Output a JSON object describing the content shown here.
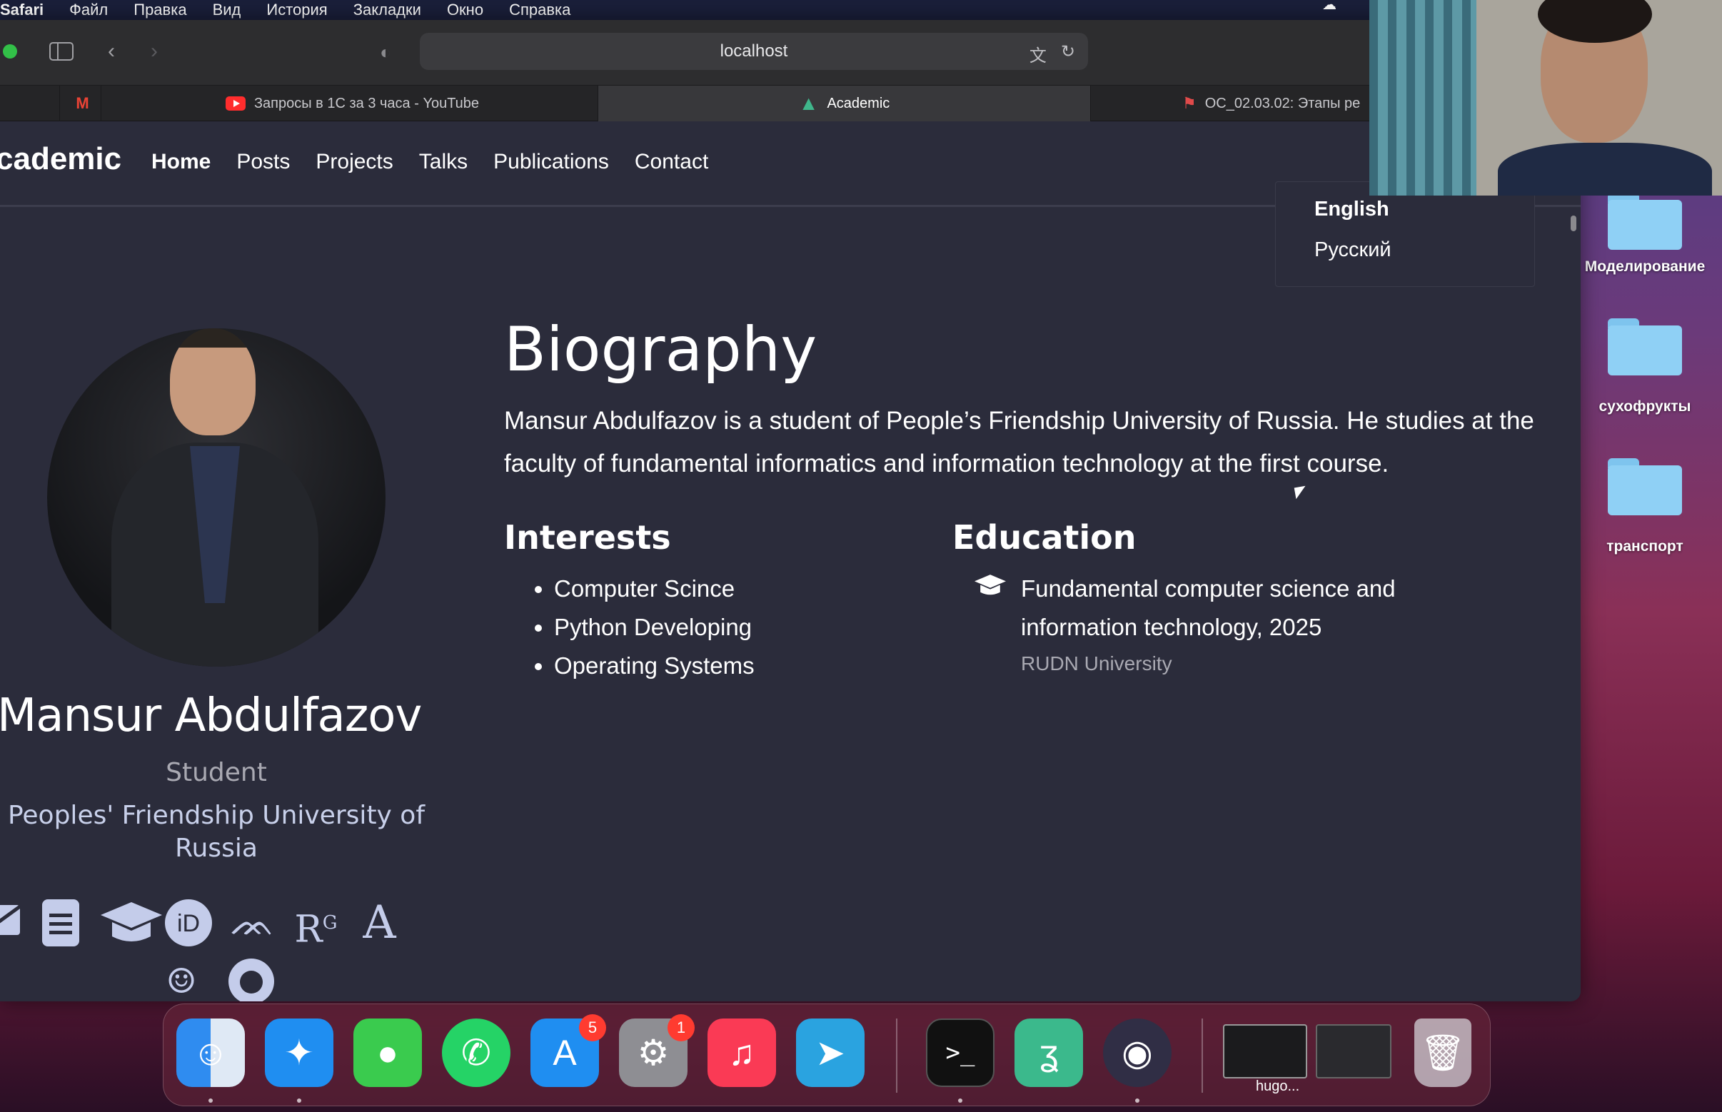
{
  "menubar": {
    "items": [
      "Safari",
      "Файл",
      "Правка",
      "Вид",
      "История",
      "Закладки",
      "Окно",
      "Справка"
    ]
  },
  "toolbar": {
    "address": "localhost",
    "back_icon": "chevron-left-icon",
    "forward_icon": "chevron-right-icon"
  },
  "tabs": [
    {
      "label": "Запросы в 1С за 3 часа - YouTube",
      "icon": "youtube-icon",
      "active": false
    },
    {
      "label": "Academic",
      "icon": "academic-icon",
      "active": true
    },
    {
      "label": "ОС_02.03.02: Этапы ре",
      "icon": "moodle-icon",
      "active": false
    }
  ],
  "site": {
    "brand": "cademic",
    "nav": [
      "Home",
      "Posts",
      "Projects",
      "Talks",
      "Publications",
      "Contact"
    ],
    "lang_menu": [
      "English",
      "Русский"
    ]
  },
  "profile": {
    "name": "Mansur Abdulfazov",
    "role": "Student",
    "organization": "Peoples' Friendship University of Russia",
    "social_icons": [
      "envelope-icon",
      "cv-icon",
      "graduation-cap-icon",
      "orcid-icon",
      "mendeley-icon",
      "researchgate-icon",
      "academia-icon",
      "keybase-icon",
      "github-icon"
    ]
  },
  "biography": {
    "title": "Biography",
    "text": "Mansur Abdulfazov is a student of People’s Friendship University of Russia. He studies at the faculty of fundamental informatics and information technology at the first course."
  },
  "interests": {
    "title": "Interests",
    "items": [
      "Computer Scince",
      "Python Developing",
      "Operating Systems"
    ]
  },
  "education": {
    "title": "Education",
    "course": "Fundamental computer science and information technology, 2025",
    "institution": "RUDN University"
  },
  "desktop": {
    "folders": [
      "Моделирование",
      "сухофрукты",
      "транспорт"
    ]
  },
  "dock": {
    "apps": [
      {
        "name": "Finder",
        "icon": "finder-icon",
        "color": "#2f8cf0"
      },
      {
        "name": "Safari",
        "icon": "safari-icon",
        "color": "#1f8ef1"
      },
      {
        "name": "Messages",
        "icon": "messages-icon",
        "color": "#3acb4e"
      },
      {
        "name": "WhatsApp",
        "icon": "whatsapp-icon",
        "color": "#25d366"
      },
      {
        "name": "App Store",
        "icon": "app-store-icon",
        "color": "#1f8ef1",
        "badge": "5"
      },
      {
        "name": "System Preferences",
        "icon": "system-preferences-icon",
        "color": "#8e8e93",
        "badge": "1"
      },
      {
        "name": "Music",
        "icon": "music-icon",
        "color": "#fa3a55"
      },
      {
        "name": "Telegram",
        "icon": "telegram-icon",
        "color": "#2aa3e0"
      },
      {
        "name": "Terminal",
        "icon": "terminal-icon",
        "color": "#111111"
      },
      {
        "name": "Scrivener",
        "icon": "app-icon",
        "color": "#3bb98c"
      },
      {
        "name": "OBS",
        "icon": "obs-icon",
        "color": "#302e45"
      }
    ],
    "minimized_label": "hugo..."
  }
}
